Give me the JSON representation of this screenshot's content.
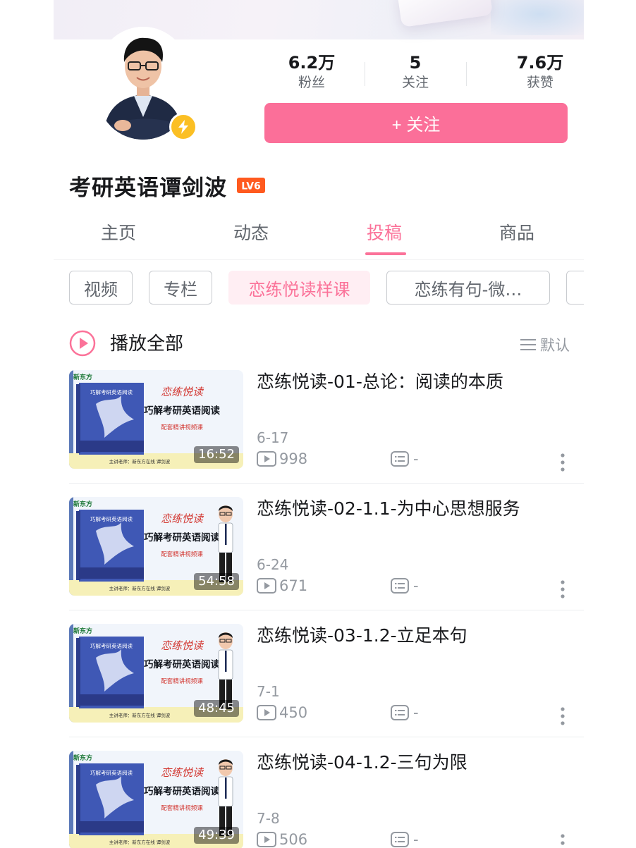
{
  "profile": {
    "name": "考研英语谭剑波",
    "level_badge": "LV6",
    "stats": [
      {
        "value": "6.2万",
        "label": "粉丝"
      },
      {
        "value": "5",
        "label": "关注"
      },
      {
        "value": "7.6万",
        "label": "获赞"
      }
    ],
    "follow_label": "+ 关注",
    "accent_color": "#fb7299"
  },
  "tabs": [
    {
      "label": "主页"
    },
    {
      "label": "动态"
    },
    {
      "label": "投稿",
      "active": true
    },
    {
      "label": "商品"
    }
  ],
  "chips": [
    {
      "label": "视频"
    },
    {
      "label": "专栏"
    },
    {
      "label": "恋练悦读样课",
      "active": true
    },
    {
      "label": "恋练有句-微…"
    }
  ],
  "play_all": {
    "label": "播放全部",
    "sort_label": "默认"
  },
  "thumbnail": {
    "brand": "新东方",
    "series_logo": "恋练悦读",
    "book_title": "巧解考研英语阅读",
    "subtitle": "配套精讲视频课",
    "lecturer": "主讲老师：新东方在线 谭剑波"
  },
  "videos": [
    {
      "title": "恋练悦读-01-总论：阅读的本质",
      "duration": "16:52",
      "date": "6-17",
      "views": "998",
      "danmaku": "-"
    },
    {
      "title": "恋练悦读-02-1.1-为中心思想服务",
      "duration": "54:58",
      "date": "6-24",
      "views": "671",
      "danmaku": "-"
    },
    {
      "title": "恋练悦读-03-1.2-立足本句",
      "duration": "48:45",
      "date": "7-1",
      "views": "450",
      "danmaku": "-"
    },
    {
      "title": "恋练悦读-04-1.2-三句为限",
      "duration": "49:39",
      "date": "7-8",
      "views": "506",
      "danmaku": "-"
    }
  ]
}
